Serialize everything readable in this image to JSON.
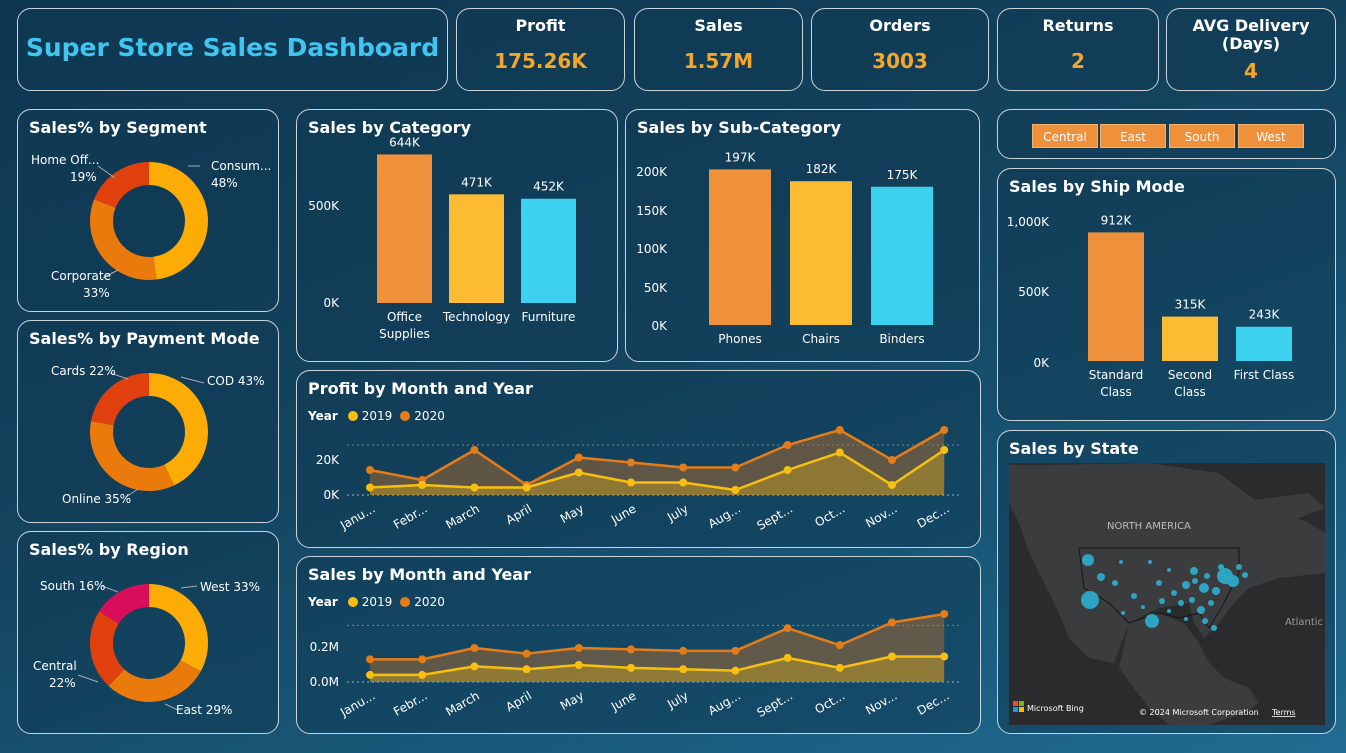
{
  "title": "Super Store Sales Dashboard",
  "kpis": [
    {
      "label": "Profit",
      "value": "175.26K"
    },
    {
      "label": "Sales",
      "value": "1.57M"
    },
    {
      "label": "Orders",
      "value": "3003"
    },
    {
      "label": "Returns",
      "value": "2"
    },
    {
      "label": "AVG Delivery (Days)",
      "value": "4"
    }
  ],
  "colors": {
    "orange": "#ee913a",
    "yellow": "#fbbb32",
    "cyan": "#3bd1ef",
    "donut_yellow": "#fcac04",
    "donut_orange": "#ea7a0c",
    "donut_red": "#e0400d",
    "donut_pink": "#d90e5a",
    "line2019": "#f7c011",
    "line2020": "#e57c1a"
  },
  "segment": {
    "title": "Sales% by Segment",
    "labels": [
      "Consum...",
      "48%",
      "Home Off...",
      "19%",
      "Corporate",
      "33%"
    ]
  },
  "payment": {
    "title": "Sales% by Payment Mode",
    "labels": [
      "COD 43%",
      "Cards 22%",
      "Online 35%"
    ]
  },
  "region": {
    "title": "Sales% by Region",
    "labels": [
      "West 33%",
      "South 16%",
      "Central",
      "22%",
      "East 29%"
    ]
  },
  "category": {
    "title": "Sales by Category",
    "yticks": [
      "500K",
      "0K"
    ]
  },
  "subcategory": {
    "title": "Sales by Sub-Category",
    "yticks": [
      "200K",
      "150K",
      "100K",
      "50K",
      "0K"
    ]
  },
  "shipmode": {
    "title": "Sales by Ship Mode",
    "yticks": [
      "1,000K",
      "500K",
      "0K"
    ]
  },
  "slicer": {
    "buttons": [
      "Central",
      "East",
      "South",
      "West"
    ]
  },
  "profit_trend": {
    "title": "Profit by Month and Year",
    "legend_title": "Year",
    "legend": [
      "2019",
      "2020"
    ],
    "yticks": [
      "20K",
      "0K"
    ]
  },
  "sales_trend": {
    "title": "Sales by Month and Year",
    "legend_title": "Year",
    "legend": [
      "2019",
      "2020"
    ],
    "yticks": [
      "0.2M",
      "0.0M"
    ]
  },
  "months_short": [
    "Janu...",
    "Febr...",
    "March",
    "April",
    "May",
    "June",
    "July",
    "Aug...",
    "Sept...",
    "Oct...",
    "Nov...",
    "Dec..."
  ],
  "map": {
    "title": "Sales by State",
    "region_label": "NORTH AMERICA",
    "ocean_label": "Atlantic",
    "brand": "Microsoft Bing",
    "copyright": "© 2024 Microsoft Corporation",
    "terms": "Terms"
  },
  "chart_data": [
    {
      "type": "pie",
      "title": "Sales% by Segment",
      "categories": [
        "Consumer",
        "Corporate",
        "Home Office"
      ],
      "values": [
        48,
        33,
        19
      ]
    },
    {
      "type": "pie",
      "title": "Sales% by Payment Mode",
      "categories": [
        "COD",
        "Online",
        "Cards"
      ],
      "values": [
        43,
        35,
        22
      ]
    },
    {
      "type": "pie",
      "title": "Sales% by Region",
      "categories": [
        "West",
        "East",
        "Central",
        "South"
      ],
      "values": [
        33,
        29,
        22,
        16
      ]
    },
    {
      "type": "bar",
      "title": "Sales by Category",
      "categories": [
        "Office Supplies",
        "Technology",
        "Furniture"
      ],
      "values": [
        644,
        471,
        452
      ],
      "value_labels": [
        "644K",
        "471K",
        "452K"
      ],
      "ylim": [
        0,
        750
      ]
    },
    {
      "type": "bar",
      "title": "Sales by Sub-Category",
      "categories": [
        "Phones",
        "Chairs",
        "Binders"
      ],
      "values": [
        197,
        182,
        175
      ],
      "value_labels": [
        "197K",
        "182K",
        "175K"
      ],
      "ylim": [
        0,
        200
      ]
    },
    {
      "type": "bar",
      "title": "Sales by Ship Mode",
      "categories": [
        "Standard Class",
        "Second Class",
        "First Class"
      ],
      "values": [
        912,
        315,
        243
      ],
      "value_labels": [
        "912K",
        "315K",
        "243K"
      ],
      "ylim": [
        0,
        1000
      ]
    },
    {
      "type": "area",
      "title": "Profit by Month and Year",
      "categories": [
        "January",
        "February",
        "March",
        "April",
        "May",
        "June",
        "July",
        "August",
        "September",
        "October",
        "November",
        "December"
      ],
      "series": [
        {
          "name": "2019",
          "values": [
            3,
            4,
            3,
            3,
            9,
            5,
            5,
            2,
            10,
            17,
            4,
            18
          ]
        },
        {
          "name": "2020",
          "values": [
            10,
            6,
            18,
            4,
            15,
            13,
            11,
            11,
            20,
            26,
            14,
            26
          ]
        }
      ],
      "ylim": [
        0,
        30
      ]
    },
    {
      "type": "area",
      "title": "Sales by Month and Year",
      "categories": [
        "January",
        "February",
        "March",
        "April",
        "May",
        "June",
        "July",
        "August",
        "September",
        "October",
        "November",
        "December"
      ],
      "series": [
        {
          "name": "2019",
          "values": [
            0.025,
            0.025,
            0.055,
            0.045,
            0.06,
            0.05,
            0.045,
            0.04,
            0.085,
            0.05,
            0.09,
            0.09
          ]
        },
        {
          "name": "2020",
          "values": [
            0.08,
            0.08,
            0.12,
            0.1,
            0.12,
            0.115,
            0.11,
            0.11,
            0.19,
            0.13,
            0.21,
            0.24
          ]
        }
      ],
      "ylim": [
        0,
        0.3
      ]
    }
  ]
}
